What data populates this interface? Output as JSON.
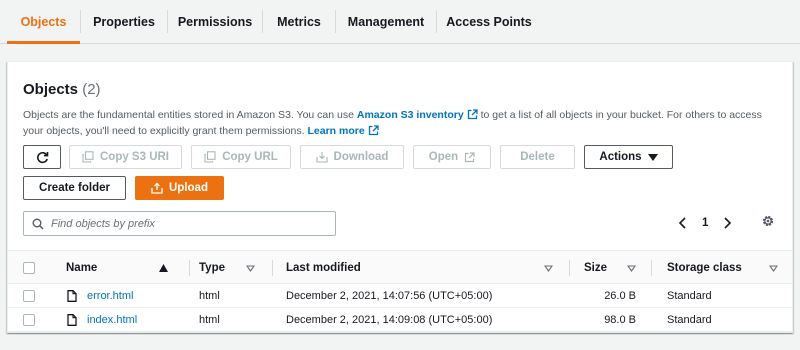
{
  "tabs": [
    {
      "label": "Objects",
      "active": true
    },
    {
      "label": "Properties"
    },
    {
      "label": "Permissions"
    },
    {
      "label": "Metrics"
    },
    {
      "label": "Management"
    },
    {
      "label": "Access Points"
    }
  ],
  "objects_panel": {
    "title": "Objects",
    "count": "(2)",
    "description_pre": "Objects are the fundamental entities stored in Amazon S3. You can use ",
    "inventory_link": "Amazon S3 inventory",
    "description_mid": " to get a list of all objects in your bucket. For others to access your objects, you'll need to explicitly grant them permissions. ",
    "learn_more": "Learn more"
  },
  "toolbar": {
    "refresh_icon": "refresh-icon",
    "copy_s3_uri": "Copy S3 URI",
    "copy_url": "Copy URL",
    "download": "Download",
    "open": "Open",
    "delete": "Delete",
    "actions": "Actions",
    "create_folder": "Create folder",
    "upload": "Upload"
  },
  "search": {
    "placeholder": "Find objects by prefix",
    "value": ""
  },
  "pagination": {
    "current_page": "1"
  },
  "table": {
    "headers": {
      "name": "Name",
      "type": "Type",
      "last_modified": "Last modified",
      "size": "Size",
      "storage_class": "Storage class"
    },
    "rows": [
      {
        "name": "error.html",
        "type": "html",
        "last_modified": "December 2, 2021, 14:07:56 (UTC+05:00)",
        "size": "26.0 B",
        "storage_class": "Standard"
      },
      {
        "name": "index.html",
        "type": "html",
        "last_modified": "December 2, 2021, 14:09:08 (UTC+05:00)",
        "size": "98.0 B",
        "storage_class": "Standard"
      }
    ]
  },
  "colors": {
    "accent": "#ec7211",
    "link": "#0073bb",
    "disabled": "#aab7b8"
  }
}
